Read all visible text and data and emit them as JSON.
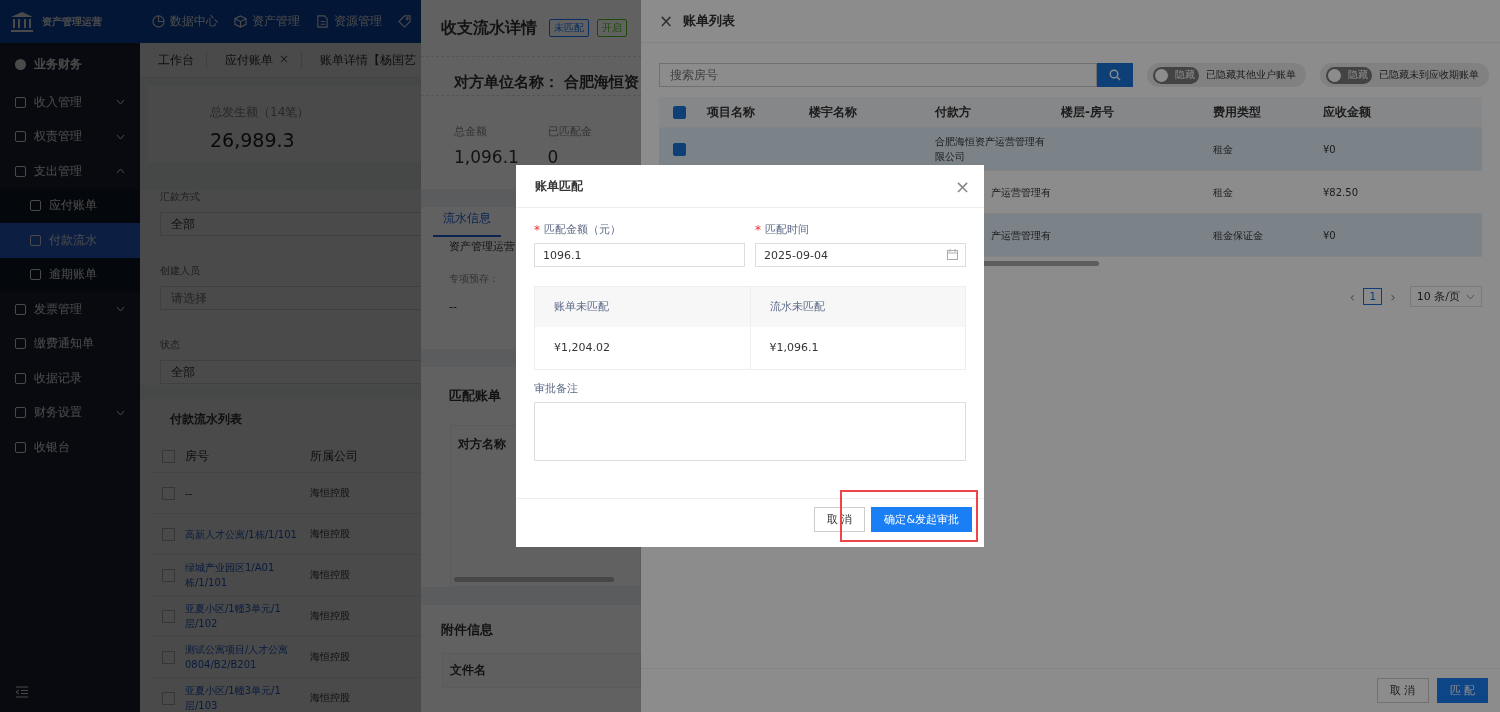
{
  "app": {
    "logo_text": "资产管理运营",
    "top_nav": [
      {
        "label": "数据中心"
      },
      {
        "label": "资产管理"
      },
      {
        "label": "资源管理"
      }
    ],
    "sidebar": {
      "section": "业务财务",
      "items": [
        {
          "label": "收入管理",
          "expanded": false,
          "selected": false
        },
        {
          "label": "权责管理",
          "expanded": false,
          "selected": false
        },
        {
          "label": "支出管理",
          "expanded": true,
          "selected": false,
          "children": [
            {
              "label": "应付账单",
              "selected": false
            },
            {
              "label": "付款流水",
              "selected": true
            },
            {
              "label": "逾期账单",
              "selected": false
            }
          ]
        },
        {
          "label": "发票管理",
          "expanded": false,
          "selected": false
        },
        {
          "label": "缴费通知单",
          "selected": false
        },
        {
          "label": "收据记录",
          "selected": false
        },
        {
          "label": "财务设置",
          "expanded": false,
          "selected": false
        },
        {
          "label": "收银台",
          "selected": false
        }
      ]
    },
    "tabs": [
      {
        "label": "工作台",
        "closable": false
      },
      {
        "label": "应付账单",
        "closable": true,
        "close": "×"
      },
      {
        "label": "账单详情【杨国艺",
        "closable": false
      }
    ],
    "summary": {
      "label": "总发生额（14笔）",
      "value": "26,989.3"
    },
    "filters": [
      {
        "label": "汇款方式",
        "value": "全部"
      },
      {
        "label": "创建人员",
        "placeholder": "请选择"
      },
      {
        "label": "状态",
        "value": "全部"
      }
    ],
    "list": {
      "title": "付款流水列表",
      "all_checked": false,
      "columns": [
        "房号",
        "所属公司"
      ],
      "rows": [
        {
          "checked": false,
          "room": "--",
          "company": "海恒控股",
          "link": false
        },
        {
          "checked": false,
          "room": "高新人才公寓/1栋/1/101",
          "company": "海恒控股",
          "link": true
        },
        {
          "checked": false,
          "room": "绿城产业园区1/A01栋/1/101",
          "company": "海恒控股",
          "link": true
        },
        {
          "checked": false,
          "room": "亚夏小区/1幢3单元/1层/102",
          "company": "海恒控股",
          "link": true
        },
        {
          "checked": false,
          "room": "测试公寓项目/人才公寓0804/B2/B201",
          "company": "海恒控股",
          "link": true
        },
        {
          "checked": false,
          "room": "亚夏小区/1幢3单元/1层/103",
          "company": "海恒控股",
          "link": true
        }
      ]
    }
  },
  "detail_drawer": {
    "title": "收支流水详情",
    "tags": [
      {
        "label": "未匹配",
        "kind": "info"
      },
      {
        "label": "开启",
        "kind": "success"
      }
    ],
    "counterparty": "对方单位名称：  合肥海恒资",
    "stats": [
      {
        "label": "总金额",
        "value": "1,096.1"
      },
      {
        "label": "已匹配金",
        "value": "0"
      }
    ],
    "tabs": [
      {
        "label": "流水信息",
        "selected": true
      }
    ],
    "cut_text": "资产管理运营",
    "field": {
      "label": "专项预存：",
      "value": "--"
    },
    "match_section": {
      "title": "匹配账单",
      "column": "对方名称"
    },
    "attachments": {
      "title": "附件信息",
      "column": "文件名"
    }
  },
  "bill_drawer": {
    "close": "×",
    "title": "账单列表",
    "search": {
      "placeholder": "搜索房号"
    },
    "toggles": [
      {
        "label": "隐藏",
        "caption": "已隐藏其他业户账单",
        "on": false
      },
      {
        "label": "隐藏",
        "caption": "已隐藏未到应收期账单",
        "on": false
      }
    ],
    "all_checked": true,
    "columns": [
      "项目名称",
      "楼宇名称",
      "付款方",
      "楼层-房号",
      "费用类型",
      "应收金额"
    ],
    "rows": [
      {
        "checked": true,
        "selected": true,
        "payer": "合肥海恒资产运营管理有限公司",
        "fee_type": "租金",
        "amount": "¥0"
      },
      {
        "selected": false,
        "payer": "产运营管理有",
        "fee_type": "租金",
        "amount": "¥82.50"
      },
      {
        "selected": true,
        "payer": "产运营管理有",
        "fee_type": "租金保证金",
        "amount": "¥0"
      }
    ],
    "pagination": {
      "prev": "‹",
      "page": "1",
      "next": "›",
      "size": "10 条/页"
    },
    "buttons": [
      {
        "label": "取 消",
        "kind": "default"
      },
      {
        "label": "匹 配",
        "kind": "primary"
      }
    ]
  },
  "modal": {
    "title": "账单匹配",
    "close": "×",
    "fields": [
      {
        "label": "匹配金额（元）",
        "required_mark": "*",
        "value": "1096.1",
        "kind": "text"
      },
      {
        "label": "匹配时间",
        "required_mark": "*",
        "value": "2025-09-04",
        "kind": "date"
      }
    ],
    "balance": [
      {
        "label": "账单未匹配",
        "value": "¥1,204.02"
      },
      {
        "label": "流水未匹配",
        "value": "¥1,096.1"
      }
    ],
    "remark": {
      "label": "审批备注"
    },
    "buttons": [
      {
        "label": "取 消",
        "kind": "default",
        "highlighted": false
      },
      {
        "label": "确定&发起审批",
        "kind": "primary",
        "highlighted": true
      }
    ]
  }
}
